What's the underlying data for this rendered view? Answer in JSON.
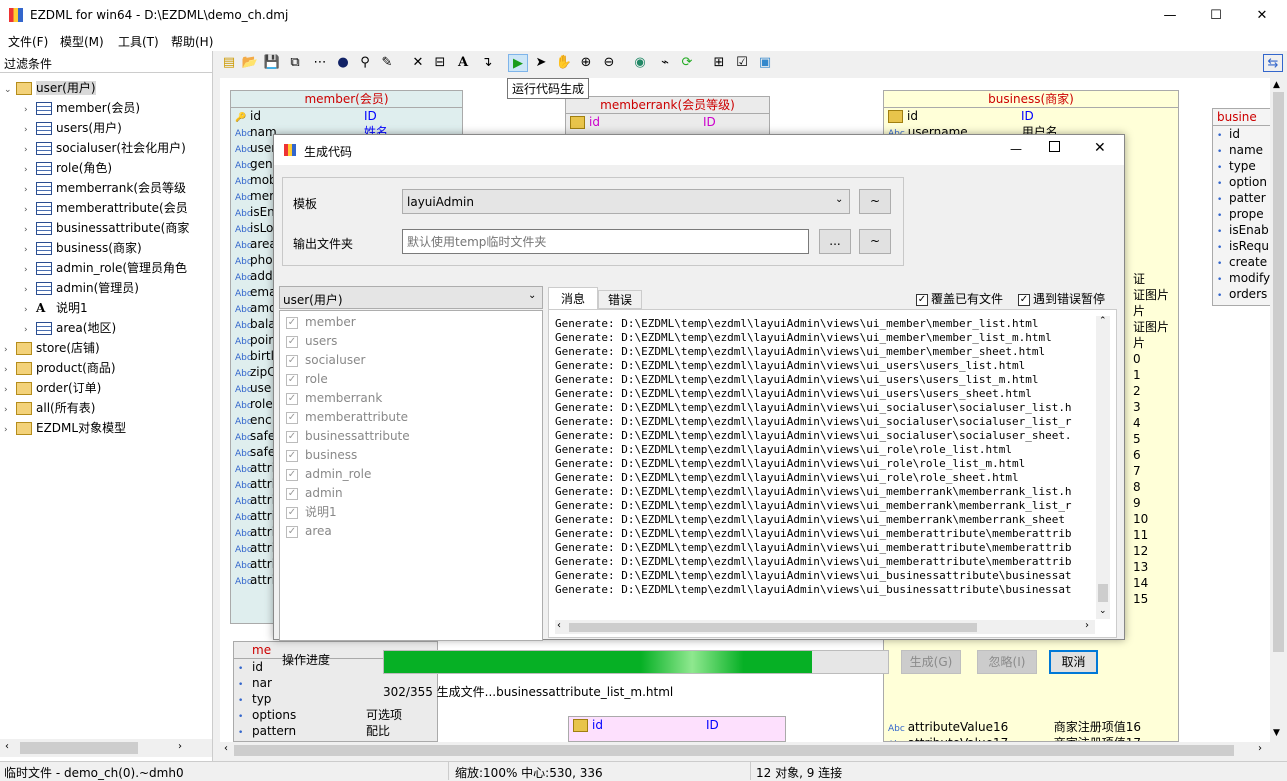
{
  "window": {
    "title": "EZDML for win64 - D:\\EZDML\\demo_ch.dmj",
    "min": "—",
    "max": "☐",
    "close": "✕"
  },
  "menu": [
    "文件(F)",
    "模型(M)",
    "工具(T)",
    "帮助(H)"
  ],
  "left": {
    "filter_label": "过滤条件",
    "tree": [
      {
        "label": "user(用户)",
        "level": 0,
        "type": "folder",
        "open": true,
        "selected": true
      },
      {
        "label": "member(会员)",
        "level": 1,
        "type": "table"
      },
      {
        "label": "users(用户)",
        "level": 1,
        "type": "table"
      },
      {
        "label": "socialuser(社会化用户)",
        "level": 1,
        "type": "table"
      },
      {
        "label": "role(角色)",
        "level": 1,
        "type": "table"
      },
      {
        "label": "memberrank(会员等级",
        "level": 1,
        "type": "table"
      },
      {
        "label": "memberattribute(会员",
        "level": 1,
        "type": "table"
      },
      {
        "label": "businessattribute(商家",
        "level": 1,
        "type": "table"
      },
      {
        "label": "business(商家)",
        "level": 1,
        "type": "table"
      },
      {
        "label": "admin_role(管理员角色",
        "level": 1,
        "type": "table"
      },
      {
        "label": "admin(管理员)",
        "level": 1,
        "type": "table"
      },
      {
        "label": "说明1",
        "level": 1,
        "type": "text"
      },
      {
        "label": "area(地区)",
        "level": 1,
        "type": "table"
      },
      {
        "label": "store(店铺)",
        "level": 0,
        "type": "folder"
      },
      {
        "label": "product(商品)",
        "level": 0,
        "type": "folder"
      },
      {
        "label": "order(订单)",
        "level": 0,
        "type": "folder"
      },
      {
        "label": "all(所有表)",
        "level": 0,
        "type": "folder"
      },
      {
        "label": "EZDML对象模型",
        "level": 0,
        "type": "folder"
      }
    ]
  },
  "tooltip": "运行代码生成",
  "entities": {
    "member": {
      "title": "member(会员)",
      "rows": [
        [
          "id",
          "ID"
        ],
        [
          "nam",
          "姓名"
        ],
        [
          "user",
          ""
        ],
        [
          "gen",
          ""
        ],
        [
          "mob",
          ""
        ],
        [
          "mer",
          ""
        ],
        [
          "isEn",
          ""
        ],
        [
          "isLo",
          ""
        ],
        [
          "area",
          ""
        ],
        [
          "pho",
          ""
        ],
        [
          "add",
          ""
        ],
        [
          "ema",
          ""
        ],
        [
          "amo",
          ""
        ],
        [
          "bala",
          ""
        ],
        [
          "poir",
          ""
        ],
        [
          "birtl",
          ""
        ],
        [
          "zipC",
          ""
        ],
        [
          "use",
          ""
        ],
        [
          "role",
          ""
        ],
        [
          "enc",
          ""
        ],
        [
          "safe",
          ""
        ],
        [
          "safe",
          ""
        ],
        [
          "attri",
          ""
        ],
        [
          "attri",
          ""
        ],
        [
          "attri",
          ""
        ],
        [
          "attri",
          ""
        ],
        [
          "attri",
          ""
        ],
        [
          "attri",
          ""
        ],
        [
          "attri",
          ""
        ],
        [
          "attri",
          ""
        ]
      ]
    },
    "memberrank": {
      "title": "memberrank(会员等级)",
      "rows": [
        [
          "id",
          "ID"
        ]
      ]
    },
    "business": {
      "title": "business(商家)",
      "rows": [
        [
          "id",
          "ID"
        ],
        [
          "username",
          "用户名"
        ]
      ],
      "right_col": [
        "证",
        "证图片",
        "片",
        "证图片",
        "片",
        "0",
        "1",
        "2",
        "3",
        "4",
        "5",
        "6",
        "7",
        "8",
        "9",
        "10",
        "11",
        "12",
        "13",
        "14",
        "15"
      ],
      "bottom_rows": [
        [
          "attributeValue16",
          "商家注册项值16"
        ],
        [
          "attributeValue17",
          "商家注册项值17"
        ]
      ]
    },
    "business2": {
      "title": "busine",
      "rows": [
        "id",
        "name",
        "type",
        "option",
        "patter",
        "prope",
        "isEnab",
        "isRequ",
        "create",
        "modify",
        "orders"
      ]
    },
    "memberattr": {
      "title": "me",
      "rows": [
        "id",
        "nar",
        "typ",
        "options",
        "pattern"
      ],
      "comments": [
        "",
        "",
        "",
        "可选项",
        "配比"
      ]
    },
    "pink": {
      "rows": [
        [
          "id",
          "ID"
        ]
      ]
    }
  },
  "dialog": {
    "title": "生成代码",
    "template_label": "模板",
    "template_value": "layuiAdmin",
    "output_label": "输出文件夹",
    "output_placeholder": "默认使用temp临时文件夹",
    "tilde": "~",
    "dots": "...",
    "model_select": "user(用户)",
    "tables": [
      "member",
      "users",
      "socialuser",
      "role",
      "memberrank",
      "memberattribute",
      "businessattribute",
      "business",
      "admin_role",
      "admin",
      "说明1",
      "area"
    ],
    "tabs": [
      "消息",
      "错误"
    ],
    "overwrite": "覆盖已有文件",
    "pause_on_error": "遇到错误暂停",
    "log": [
      "Generate: D:\\EZDML\\temp\\ezdml\\layuiAdmin\\views\\ui_member\\member_list.html",
      "Generate: D:\\EZDML\\temp\\ezdml\\layuiAdmin\\views\\ui_member\\member_list_m.html",
      "Generate: D:\\EZDML\\temp\\ezdml\\layuiAdmin\\views\\ui_member\\member_sheet.html",
      "Generate: D:\\EZDML\\temp\\ezdml\\layuiAdmin\\views\\ui_users\\users_list.html",
      "Generate: D:\\EZDML\\temp\\ezdml\\layuiAdmin\\views\\ui_users\\users_list_m.html",
      "Generate: D:\\EZDML\\temp\\ezdml\\layuiAdmin\\views\\ui_users\\users_sheet.html",
      "Generate: D:\\EZDML\\temp\\ezdml\\layuiAdmin\\views\\ui_socialuser\\socialuser_list.h",
      "Generate: D:\\EZDML\\temp\\ezdml\\layuiAdmin\\views\\ui_socialuser\\socialuser_list_r",
      "Generate: D:\\EZDML\\temp\\ezdml\\layuiAdmin\\views\\ui_socialuser\\socialuser_sheet.",
      "Generate: D:\\EZDML\\temp\\ezdml\\layuiAdmin\\views\\ui_role\\role_list.html",
      "Generate: D:\\EZDML\\temp\\ezdml\\layuiAdmin\\views\\ui_role\\role_list_m.html",
      "Generate: D:\\EZDML\\temp\\ezdml\\layuiAdmin\\views\\ui_role\\role_sheet.html",
      "Generate: D:\\EZDML\\temp\\ezdml\\layuiAdmin\\views\\ui_memberrank\\memberrank_list.h",
      "Generate: D:\\EZDML\\temp\\ezdml\\layuiAdmin\\views\\ui_memberrank\\memberrank_list_r",
      "Generate: D:\\EZDML\\temp\\ezdml\\layuiAdmin\\views\\ui_memberrank\\memberrank_sheet",
      "Generate: D:\\EZDML\\temp\\ezdml\\layuiAdmin\\views\\ui_memberattribute\\memberattrib",
      "Generate: D:\\EZDML\\temp\\ezdml\\layuiAdmin\\views\\ui_memberattribute\\memberattrib",
      "Generate: D:\\EZDML\\temp\\ezdml\\layuiAdmin\\views\\ui_memberattribute\\memberattrib",
      "Generate: D:\\EZDML\\temp\\ezdml\\layuiAdmin\\views\\ui_businessattribute\\businessat",
      "Generate: D:\\EZDML\\temp\\ezdml\\layuiAdmin\\views\\ui_businessattribute\\businessat"
    ],
    "progress_label": "操作进度",
    "progress_fraction": 0.85,
    "generate_btn": "生成(G)",
    "ignore_btn": "忽略(I)",
    "cancel_btn": "取消",
    "progress_text": "302/355 生成文件...businessattribute_list_m.html"
  },
  "status": {
    "left": "临时文件 - demo_ch(0).~dmh0",
    "mid": "缩放:100% 中心:530, 336",
    "right": "12 对象, 9 连接"
  },
  "colors": {
    "accent": "#0078d7",
    "progress": "#06b025",
    "entity_title": "#cc0000"
  }
}
